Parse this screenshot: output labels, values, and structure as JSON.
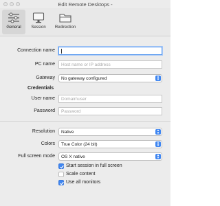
{
  "window": {
    "title": "Edit Remote Desktops -"
  },
  "toolbar": {
    "tabs": [
      {
        "label": "General",
        "icon": "sliders-icon",
        "active": true
      },
      {
        "label": "Session",
        "icon": "monitor-icon",
        "active": false
      },
      {
        "label": "Redirection",
        "icon": "folder-icon",
        "active": false
      }
    ]
  },
  "form": {
    "connection_name": {
      "label": "Connection name",
      "value": "",
      "placeholder": ""
    },
    "pc_name": {
      "label": "PC name",
      "placeholder": "Host name or IP address"
    },
    "gateway": {
      "label": "Gateway",
      "value": "No gateway configured"
    },
    "credentials": {
      "heading": "Credentials",
      "user_name": {
        "label": "User name",
        "placeholder": "Domain\\user"
      },
      "password": {
        "label": "Password",
        "placeholder": "Password"
      }
    },
    "resolution": {
      "label": "Resolution",
      "value": "Native"
    },
    "colors": {
      "label": "Colors",
      "value": "True Color (24 bit)"
    },
    "full_screen_mode": {
      "label": "Full screen mode",
      "value": "OS X native"
    },
    "options": [
      {
        "label": "Start session in full screen",
        "checked": true
      },
      {
        "label": "Scale content",
        "checked": false
      },
      {
        "label": "Use all monitors",
        "checked": true
      }
    ]
  },
  "colors": {
    "accent": "#3f86f1",
    "focus_ring": "#5b9bf0"
  }
}
